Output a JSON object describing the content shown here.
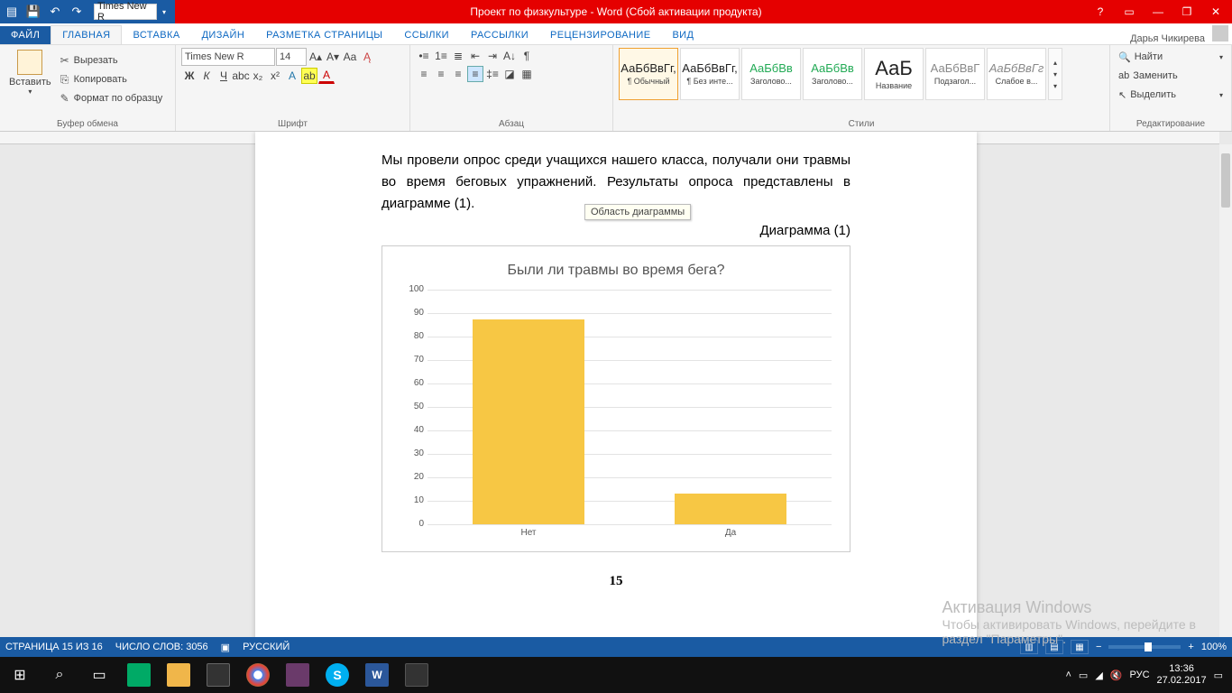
{
  "titlebar": {
    "title": "Проект по физкультуре -  Word (Сбой активации продукта)",
    "qat_font": "Times New R",
    "user": "Дарья Чикирева"
  },
  "tabs": {
    "file": "ФАЙЛ",
    "home": "ГЛАВНАЯ",
    "insert": "ВСТАВКА",
    "design": "ДИЗАЙН",
    "layout": "РАЗМЕТКА СТРАНИЦЫ",
    "refs": "ССЫЛКИ",
    "mail": "РАССЫЛКИ",
    "review": "РЕЦЕНЗИРОВАНИЕ",
    "view": "ВИД"
  },
  "ribbon": {
    "clipboard": {
      "paste": "Вставить",
      "cut": "Вырезать",
      "copy": "Копировать",
      "format": "Формат по образцу",
      "label": "Буфер обмена"
    },
    "font": {
      "name": "Times New R",
      "size": "14",
      "label": "Шрифт"
    },
    "para": {
      "label": "Абзац"
    },
    "styles": {
      "items": [
        {
          "prev": "АаБбВвГг,",
          "name": "¶ Обычный"
        },
        {
          "prev": "АаБбВвГг,",
          "name": "¶ Без инте..."
        },
        {
          "prev": "АаБбВв",
          "name": "Заголово..."
        },
        {
          "prev": "АаБбВв",
          "name": "Заголово..."
        },
        {
          "prev": "АаБ",
          "name": "Название"
        },
        {
          "prev": "АаБбВвГ",
          "name": "Подзагол..."
        },
        {
          "prev": "АаБбВвГг",
          "name": "Слабое в..."
        }
      ],
      "label": "Стили"
    },
    "editing": {
      "find": "Найти",
      "replace": "Заменить",
      "select": "Выделить",
      "label": "Редактирование"
    }
  },
  "doc": {
    "paragraph": "Мы провели опрос среди учащихся нашего класса, получали они травмы во время беговых упражнений. Результаты опроса представлены в диаграмме (1).",
    "caption": "Диаграмма (1)",
    "tooltip": "Область диаграммы",
    "page_num": "15"
  },
  "chart_data": {
    "type": "bar",
    "title": "Были ли травмы во время бега?",
    "categories": [
      "Нет",
      "Да"
    ],
    "values": [
      87,
      13
    ],
    "ylim": [
      0,
      100
    ],
    "yticks": [
      0,
      10,
      20,
      30,
      40,
      50,
      60,
      70,
      80,
      90,
      100
    ],
    "xlabel": "",
    "ylabel": ""
  },
  "watermark": {
    "title": "Активация Windows",
    "msg1": "Чтобы активировать Windows, перейдите в",
    "msg2": "раздел \"Параметры\"."
  },
  "status": {
    "page": "СТРАНИЦА 15 ИЗ 16",
    "words": "ЧИСЛО СЛОВ: 3056",
    "lang": "РУССКИЙ",
    "zoom": "100%"
  },
  "taskbar": {
    "lang": "РУС",
    "time": "13:36",
    "date": "27.02.2017"
  }
}
